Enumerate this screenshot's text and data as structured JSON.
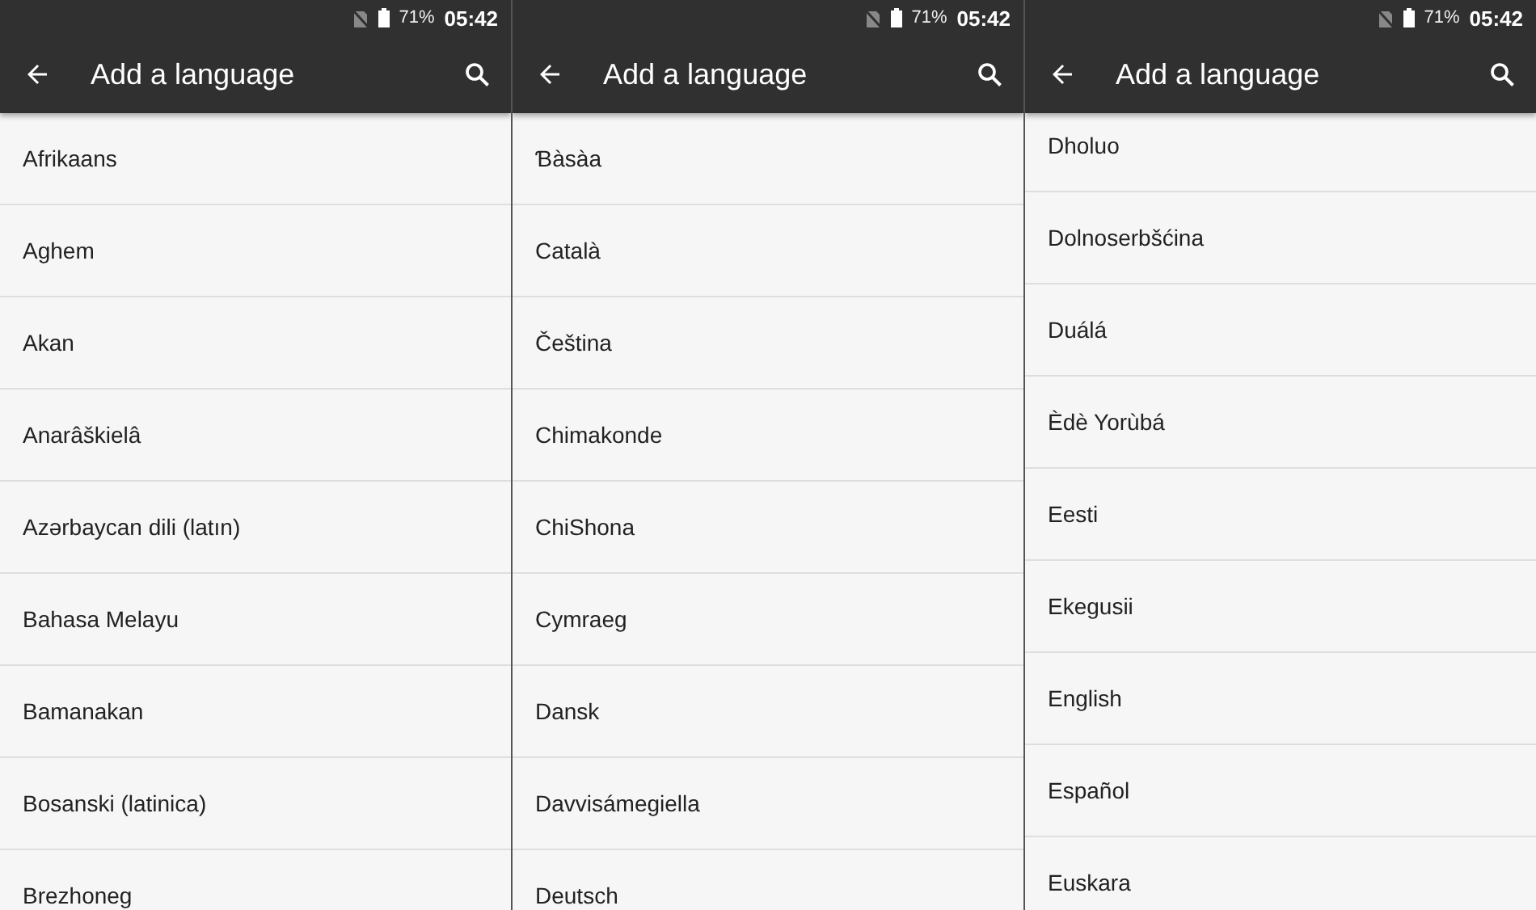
{
  "screens": [
    {
      "status_bar": {
        "battery": "71%",
        "time": "05:42"
      },
      "toolbar": {
        "title": "Add a language"
      },
      "scrolled": false,
      "languages": [
        "Afrikaans",
        "Aghem",
        "Akan",
        "Anarâškielâ",
        "Azərbaycan dili (latın)",
        "Bahasa Melayu",
        "Bamanakan",
        "Bosanski (latinica)",
        "Brezhoneg"
      ]
    },
    {
      "status_bar": {
        "battery": "71%",
        "time": "05:42"
      },
      "toolbar": {
        "title": "Add a language"
      },
      "scrolled": false,
      "languages": [
        "Ɓàsàa",
        "Català",
        "Čeština",
        "Chimakonde",
        "ChiShona",
        "Cymraeg",
        "Dansk",
        "Davvisámegiella",
        "Deutsch"
      ]
    },
    {
      "status_bar": {
        "battery": "71%",
        "time": "05:42"
      },
      "toolbar": {
        "title": "Add a language"
      },
      "scrolled": true,
      "languages": [
        "Dholuo",
        "Dolnoserbšćina",
        "Duálá",
        "Èdè Yorùbá",
        "Eesti",
        "Ekegusii",
        "English",
        "Español",
        "Euskara"
      ]
    }
  ]
}
